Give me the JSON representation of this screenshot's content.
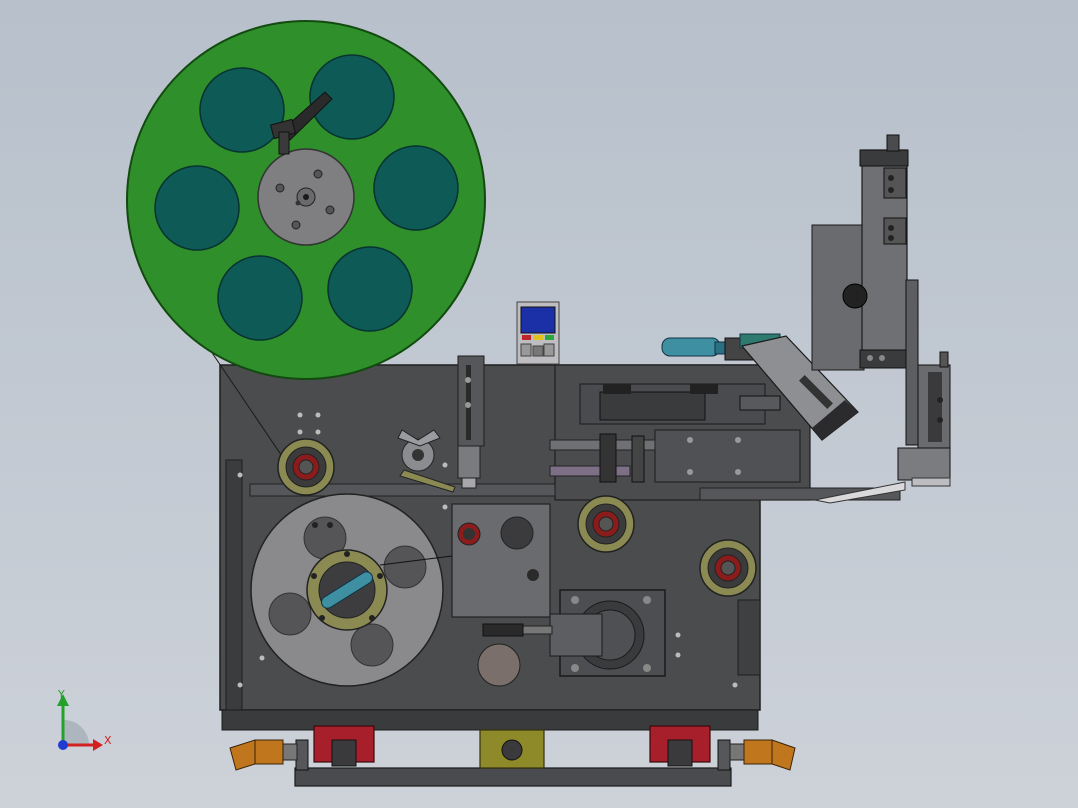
{
  "viewport": {
    "background_top": "#b7c0cb",
    "background_bottom": "#cdd2d9"
  },
  "colors": {
    "frame": "#4a4b4d",
    "frame_dark": "#2e2f31",
    "reel_green": "#2f8f2a",
    "reel_hole": "#0e5a56",
    "hub_grey": "#7f7f82",
    "roller_olive": "#8a8a52",
    "roller_red": "#8c1c1c",
    "cyan_part": "#3f8fa3",
    "rail_red": "#a61f2a",
    "orange": "#c0761c",
    "yellow_block": "#8e8a2a",
    "display_blue": "#1b2fa6"
  },
  "triad": {
    "x_label": "X",
    "y_label": "Y",
    "x_color": "#d32020",
    "y_color": "#23a12b",
    "z_color": "#1f3bd1"
  },
  "components": [
    "label-supply-reel",
    "waste-rewind-disc",
    "machine-frame",
    "control-display",
    "applicator-cylinder",
    "vertical-slide",
    "drive-motor",
    "base-rail",
    "guide-rollers"
  ]
}
